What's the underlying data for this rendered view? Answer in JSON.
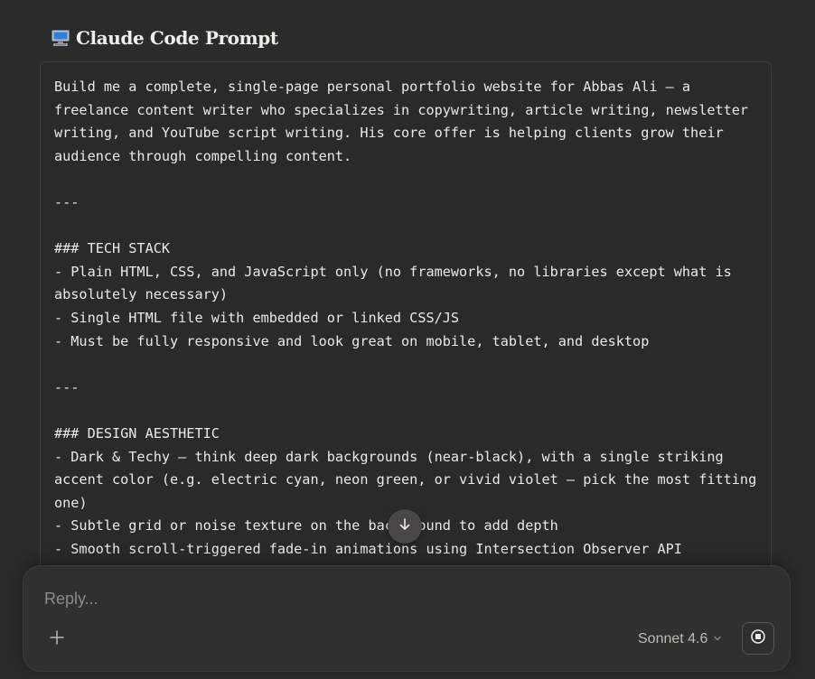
{
  "header": {
    "icon": "computer-icon",
    "title": "Claude Code Prompt"
  },
  "prompt": {
    "text": "Build me a complete, single-page personal portfolio website for Abbas Ali — a freelance content writer who specializes in copywriting, article writing, newsletter writing, and YouTube script writing. His core offer is helping clients grow their audience through compelling content.\n\n---\n\n### TECH STACK\n- Plain HTML, CSS, and JavaScript only (no frameworks, no libraries except what is absolutely necessary)\n- Single HTML file with embedded or linked CSS/JS\n- Must be fully responsive and look great on mobile, tablet, and desktop\n\n---\n\n### DESIGN AESTHETIC\n- Dark & Techy — think deep dark backgrounds (near-black), with a single striking accent color (e.g. electric cyan, neon green, or vivid violet — pick the most fitting one)\n- Subtle grid or noise texture on the background to add depth\n- Smooth scroll-triggered fade-in animations using Intersection Observer API"
  },
  "scroll_button": {
    "icon": "arrow-down-icon"
  },
  "composer": {
    "placeholder": "Reply...",
    "add_icon": "plus-icon",
    "model_label": "Sonnet 4.6",
    "model_dropdown_icon": "chevron-down-icon",
    "stop_icon": "stop-icon"
  },
  "colors": {
    "background": "#2b2b29",
    "card_background": "#2a2a28",
    "text": "#ebeae4",
    "muted_text": "#8d8c87"
  }
}
